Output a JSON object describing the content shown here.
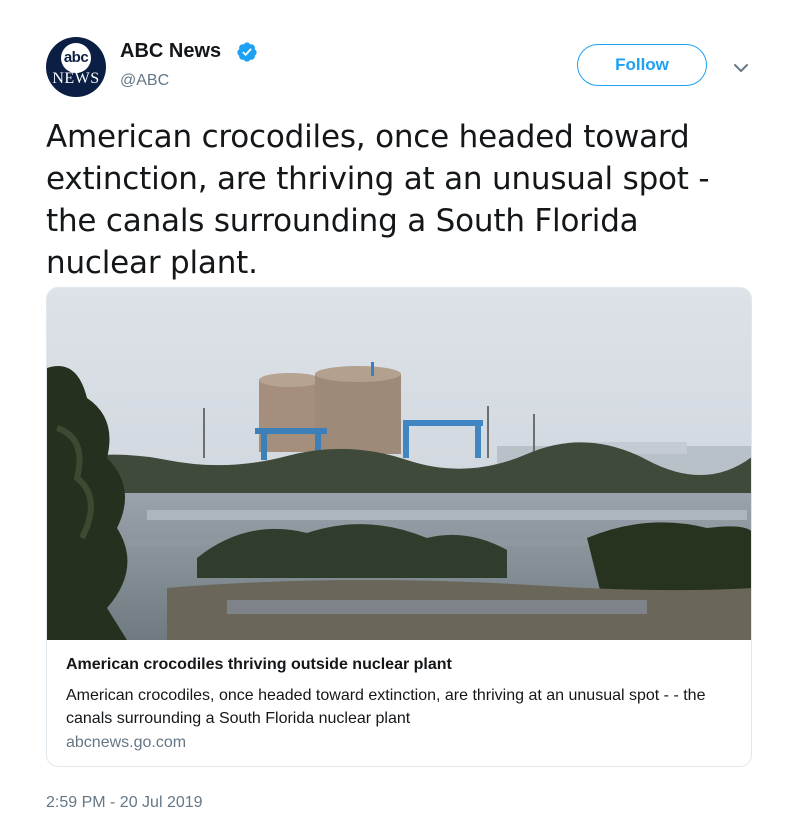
{
  "author": {
    "avatar_top_text": "abc",
    "avatar_bottom_text": "NEWS",
    "name": "ABC News",
    "handle": "@ABC",
    "verified_icon": "verified-badge-icon"
  },
  "actions": {
    "follow_label": "Follow",
    "more_icon": "chevron-down-icon"
  },
  "tweet": {
    "text": "American crocodiles, once headed toward extinction, are thriving at an unusual spot - the canals surrounding a South Florida nuclear plant.",
    "timestamp": "2:59 PM - 20 Jul 2019"
  },
  "card": {
    "title": "American crocodiles thriving outside nuclear plant",
    "description": "American crocodiles, once headed toward extinction, are thriving at an unusual spot - - the canals surrounding a South Florida nuclear plant",
    "domain": "abcnews.go.com"
  },
  "colors": {
    "accent": "#1da1f2",
    "text": "#14171a",
    "secondary": "#657786",
    "border": "#e1e8ed"
  }
}
